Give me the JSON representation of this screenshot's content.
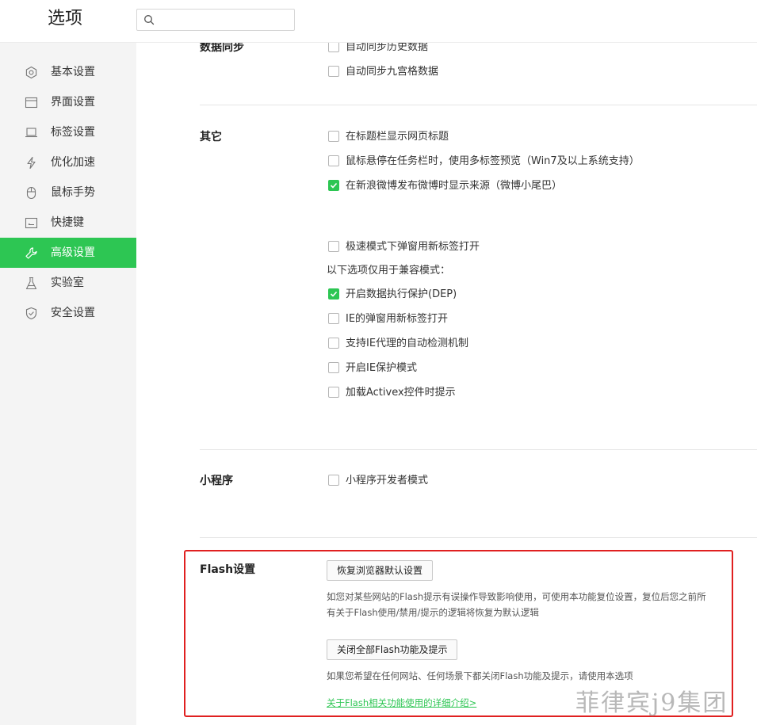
{
  "header": {
    "title": "选项",
    "search": {
      "value": "",
      "placeholder": ""
    }
  },
  "sidebar": {
    "items": [
      {
        "label": "基本设置",
        "icon": "basic-settings-icon",
        "active": false
      },
      {
        "label": "界面设置",
        "icon": "interface-icon",
        "active": false
      },
      {
        "label": "标签设置",
        "icon": "tab-icon",
        "active": false
      },
      {
        "label": "优化加速",
        "icon": "lightning-icon",
        "active": false
      },
      {
        "label": "鼠标手势",
        "icon": "mouse-icon",
        "active": false
      },
      {
        "label": "快捷键",
        "icon": "keyboard-icon",
        "active": false
      },
      {
        "label": "高级设置",
        "icon": "wrench-icon",
        "active": true
      },
      {
        "label": "实验室",
        "icon": "flask-icon",
        "active": false
      },
      {
        "label": "安全设置",
        "icon": "shield-icon",
        "active": false
      }
    ]
  },
  "sections": {
    "sync": {
      "title": "数据同步",
      "options": [
        {
          "label": "自动同步历史数据",
          "checked": false
        },
        {
          "label": "自动同步九宫格数据",
          "checked": false
        }
      ]
    },
    "other": {
      "title": "其它",
      "options": [
        {
          "label": "在标题栏显示网页标题",
          "checked": false
        },
        {
          "label": "鼠标悬停在任务栏时，使用多标签预览（Win7及以上系统支持）",
          "checked": false
        },
        {
          "label": "在新浪微博发布微博时显示来源（微博小尾巴）",
          "checked": true
        },
        {
          "label": "极速模式下弹窗用新标签打开",
          "checked": false
        }
      ],
      "compat_label": "以下选项仅用于兼容模式：",
      "compat_options": [
        {
          "label": "开启数据执行保护(DEP)",
          "checked": true
        },
        {
          "label": "IE的弹窗用新标签打开",
          "checked": false
        },
        {
          "label": "支持IE代理的自动检测机制",
          "checked": false
        },
        {
          "label": "开启IE保护模式",
          "checked": false
        },
        {
          "label": "加载Activex控件时提示",
          "checked": false
        }
      ]
    },
    "miniprogram": {
      "title": "小程序",
      "options": [
        {
          "label": "小程序开发者模式",
          "checked": false
        }
      ]
    },
    "flash": {
      "title": "Flash设置",
      "restore_button": "恢复浏览器默认设置",
      "restore_desc_line1": "如您对某些网站的Flash提示有误操作导致影响使用，可使用本功能复位设置，复位后您之前所",
      "restore_desc_line2": "有关于Flash使用/禁用/提示的逻辑将恢复为默认逻辑",
      "disable_button": "关闭全部Flash功能及提示",
      "disable_desc": "如果您希望在任何网站、任何场景下都关闭Flash功能及提示，请使用本选项",
      "detail_link": "关于Flash相关功能使用的详细介绍>"
    }
  },
  "watermark": "菲律宾j9集团",
  "colors": {
    "accent": "#2dc653",
    "highlight_border": "#e02020",
    "sidebar_bg": "#f4f4f4"
  }
}
